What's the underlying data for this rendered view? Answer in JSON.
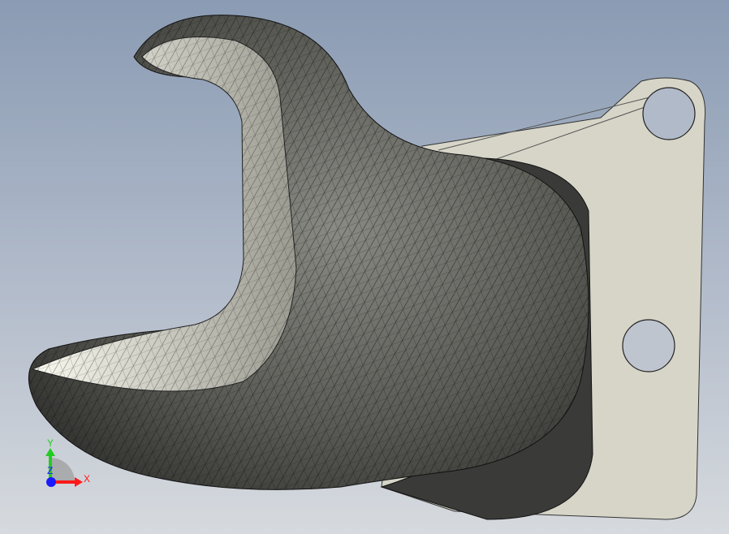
{
  "viewport": {
    "triad": {
      "x_label": "X",
      "y_label": "Y",
      "z_label": "Z"
    },
    "colors": {
      "x_axis": "#ff1a1a",
      "y_axis": "#22cc22",
      "z_axis": "#1a1aff",
      "plate": "#d6d5c8",
      "mesh_face": "#5c5c58",
      "mesh_edge": "#1a1a1a"
    }
  }
}
